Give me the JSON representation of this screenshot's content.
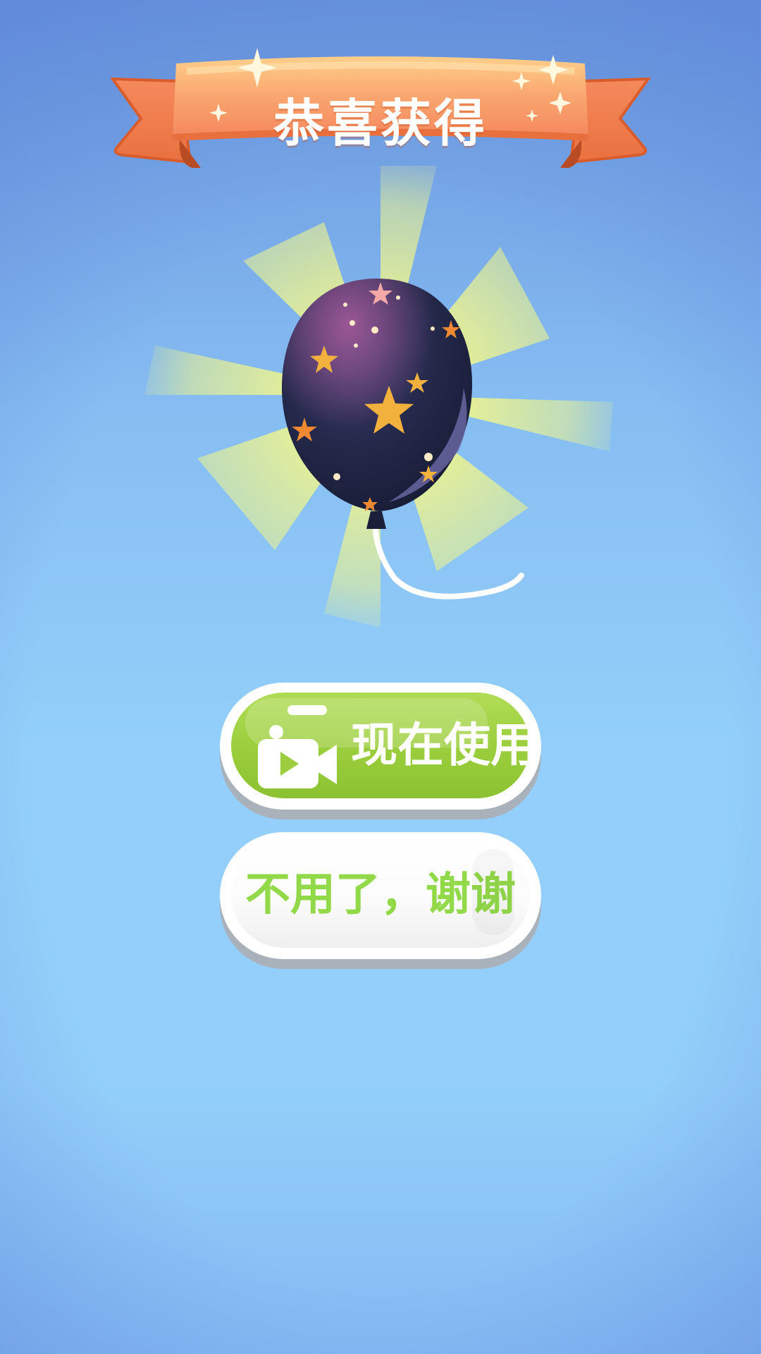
{
  "banner": {
    "title": "恭喜获得"
  },
  "reward": {
    "item": "balloon-icon"
  },
  "buttons": {
    "use_label": "现在使用",
    "use_icon": "video-camera-icon",
    "decline_label": "不用了，谢谢"
  },
  "colors": {
    "banner": "#f48a5c",
    "use_button": "#9bcd3e",
    "decline_text": "#92d94a",
    "ray": "#eef48c"
  }
}
